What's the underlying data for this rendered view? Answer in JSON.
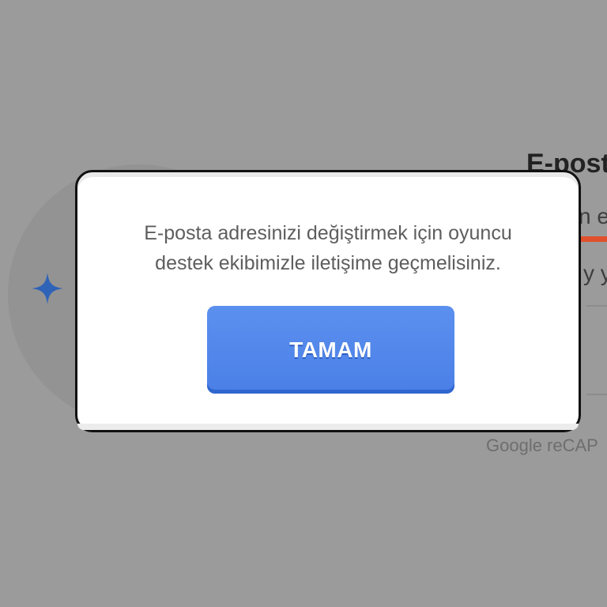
{
  "background": {
    "heading_fragment": "E-post",
    "line1_fragment": "n e",
    "line2_fragment": "y y",
    "recaptcha_fragment": "Google reCAP",
    "accent_color": "#e0502c",
    "sparkle_icon": "sparkle-icon",
    "sparkle_color": "#2f63b8"
  },
  "dialog": {
    "message_line1": "E-posta adresinizi değiştirmek için oyuncu",
    "message_line2": "destek ekibimizle iletişime geçmelisiniz.",
    "ok_button_label": "TAMAM",
    "button_color": "#5287ea"
  }
}
